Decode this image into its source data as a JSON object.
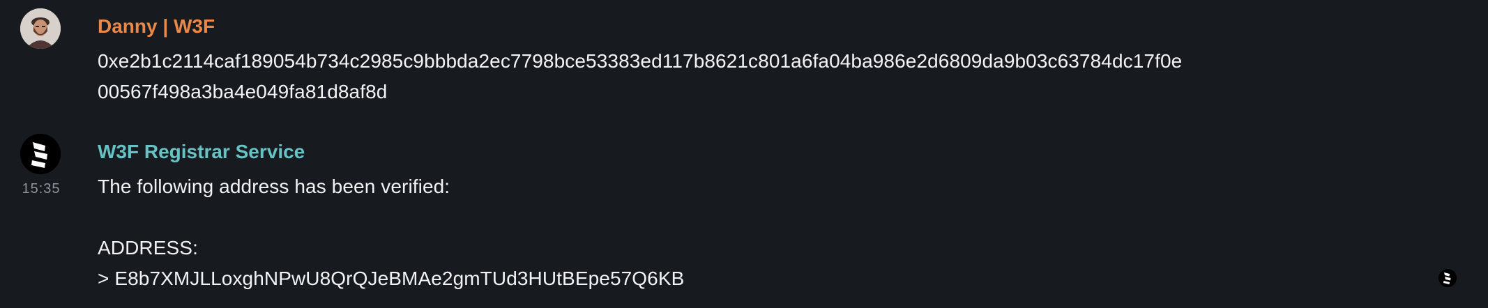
{
  "colors": {
    "background": "#171a1f",
    "message_text": "#f1f3f5",
    "timestamp": "#8e949d"
  },
  "messages": [
    {
      "sender": "Danny | W3F",
      "sender_color": "#eb8848",
      "avatar_icon": "person-avatar-icon",
      "lines": [
        "0xe2b1c2114caf189054b734c2985c9bbbda2ec7798bce53383ed117b8621c801a6fa04ba986e2d6809da9b03c63784dc17f0e",
        "00567f498a3ba4e049fa81d8af8d"
      ]
    },
    {
      "sender": "W3F Registrar Service",
      "sender_color": "#67c2c4",
      "avatar_icon": "w3f-logo-icon",
      "time": "15:35",
      "lines": [
        "The following address has been verified:",
        "",
        "ADDRESS:",
        "> E8b7XMJLLoxghNPwU8QrQJeBMAe2gmTUd3HUtBEpe57Q6KB"
      ]
    }
  ],
  "reaction": {
    "icon": "w3f-logo-reaction-icon"
  }
}
